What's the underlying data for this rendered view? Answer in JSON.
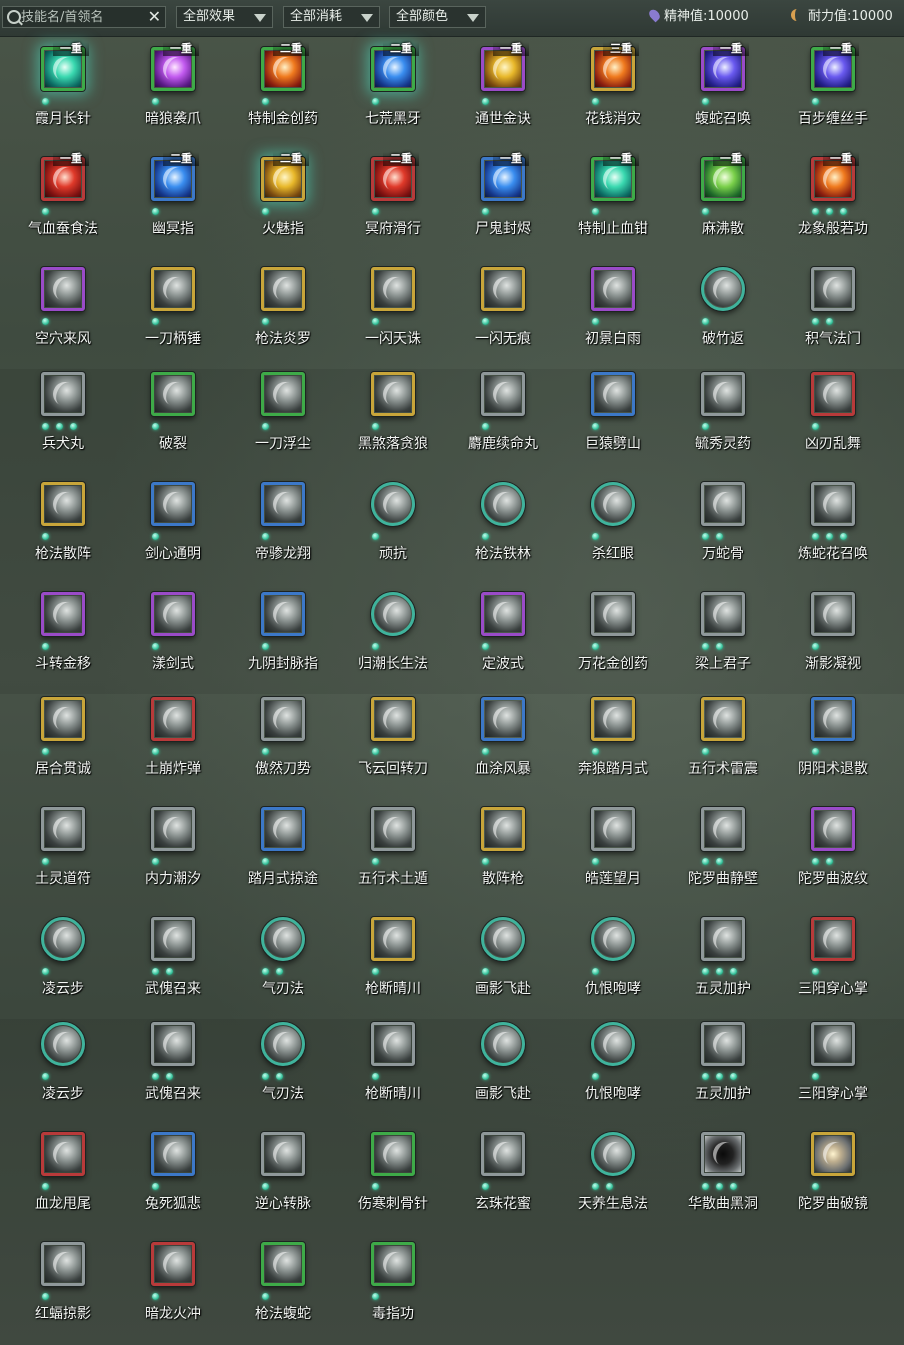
{
  "search": {
    "placeholder": "技能名/首领名",
    "value": "",
    "clear_label": "✕"
  },
  "filters": [
    {
      "label": "全部效果"
    },
    {
      "label": "全部消耗"
    },
    {
      "label": "全部颜色"
    }
  ],
  "stats": [
    {
      "label": "精神值:",
      "value": "10000",
      "icon": "spirit-icon"
    },
    {
      "label": "耐力值:",
      "value": "10000",
      "icon": "stamina-icon"
    }
  ],
  "skills": [
    {
      "name": "霞月长针",
      "badge": "一重",
      "dots": 1,
      "frame": "green",
      "shape": "square",
      "color": "teal",
      "glow": true
    },
    {
      "name": "暗狼袭爪",
      "badge": "一重",
      "dots": 1,
      "frame": "green",
      "shape": "square",
      "color": "purple"
    },
    {
      "name": "特制金创药",
      "badge": "二重",
      "dots": 1,
      "frame": "green",
      "shape": "square",
      "color": "fire"
    },
    {
      "name": "七荒黑牙",
      "badge": "二重",
      "dots": 1,
      "frame": "green",
      "shape": "square",
      "color": "blue",
      "glow": true
    },
    {
      "name": "通世金诀",
      "badge": "一重",
      "dots": 1,
      "frame": "purple",
      "shape": "square",
      "color": "gold"
    },
    {
      "name": "花钱消灾",
      "badge": "三重",
      "dots": 1,
      "frame": "gold",
      "shape": "square",
      "color": "fire"
    },
    {
      "name": "蝮蛇召唤",
      "badge": "一重",
      "dots": 1,
      "frame": "purple",
      "shape": "square",
      "color": "violet"
    },
    {
      "name": "百步缠丝手",
      "badge": "一重",
      "dots": 1,
      "frame": "green",
      "shape": "square",
      "color": "violet"
    },
    {
      "name": "气血蚕食法",
      "badge": "一重",
      "dots": 1,
      "frame": "red",
      "shape": "square",
      "color": "red"
    },
    {
      "name": "幽冥指",
      "badge": "二重",
      "dots": 1,
      "frame": "blue",
      "shape": "square",
      "color": "blue"
    },
    {
      "name": "火魅指",
      "badge": "二重",
      "dots": 1,
      "frame": "gold",
      "shape": "square",
      "color": "gold",
      "glow": true
    },
    {
      "name": "冥府滑行",
      "badge": "二重",
      "dots": 1,
      "frame": "red",
      "shape": "square",
      "color": "red"
    },
    {
      "name": "尸鬼封烬",
      "badge": "一重",
      "dots": 1,
      "frame": "blue",
      "shape": "square",
      "color": "blue"
    },
    {
      "name": "特制止血钳",
      "badge": "一重",
      "dots": 1,
      "frame": "green",
      "shape": "square",
      "color": "teal"
    },
    {
      "name": "麻沸散",
      "badge": "一重",
      "dots": 1,
      "frame": "green",
      "shape": "square",
      "color": "green"
    },
    {
      "name": "龙象般若功",
      "badge": "一重",
      "dots": 3,
      "frame": "red",
      "shape": "square",
      "color": "fire"
    },
    {
      "name": "空穴来风",
      "dots": 1,
      "frame": "purple",
      "shape": "square"
    },
    {
      "name": "一刀柄锤",
      "dots": 1,
      "frame": "gold",
      "shape": "square"
    },
    {
      "name": "枪法炎罗",
      "dots": 1,
      "frame": "gold",
      "shape": "square"
    },
    {
      "name": "一闪天诛",
      "dots": 1,
      "frame": "gold",
      "shape": "square"
    },
    {
      "name": "一闪无痕",
      "dots": 1,
      "frame": "gold",
      "shape": "square"
    },
    {
      "name": "初景白雨",
      "dots": 1,
      "frame": "purple",
      "shape": "square"
    },
    {
      "name": "破竹返",
      "dots": 1,
      "frame": "teal",
      "shape": "round"
    },
    {
      "name": "积气法门",
      "dots": 2,
      "frame": "gray",
      "shape": "square"
    },
    {
      "name": "兵犬丸",
      "dots": 3,
      "frame": "gray",
      "shape": "square"
    },
    {
      "name": "破裂",
      "dots": 1,
      "frame": "green",
      "shape": "square"
    },
    {
      "name": "一刀浮尘",
      "dots": 1,
      "frame": "green",
      "shape": "square"
    },
    {
      "name": "黑煞落贪狼",
      "dots": 1,
      "frame": "gold",
      "shape": "square"
    },
    {
      "name": "麝鹿续命丸",
      "dots": 1,
      "frame": "gray",
      "shape": "square"
    },
    {
      "name": "巨猿劈山",
      "dots": 1,
      "frame": "blue",
      "shape": "square"
    },
    {
      "name": "毓秀灵药",
      "dots": 1,
      "frame": "gray",
      "shape": "square"
    },
    {
      "name": "凶刃乱舞",
      "dots": 1,
      "frame": "red",
      "shape": "square"
    },
    {
      "name": "枪法散阵",
      "dots": 1,
      "frame": "gold",
      "shape": "square"
    },
    {
      "name": "剑心通明",
      "dots": 1,
      "frame": "blue",
      "shape": "square"
    },
    {
      "name": "帝骖龙翔",
      "dots": 1,
      "frame": "blue",
      "shape": "square"
    },
    {
      "name": "顽抗",
      "dots": 1,
      "frame": "teal",
      "shape": "round"
    },
    {
      "name": "枪法铁林",
      "dots": 1,
      "frame": "teal",
      "shape": "round"
    },
    {
      "name": "杀红眼",
      "dots": 1,
      "frame": "teal",
      "shape": "round"
    },
    {
      "name": "万蛇骨",
      "dots": 2,
      "frame": "gray",
      "shape": "square"
    },
    {
      "name": "炼蛇花召唤",
      "dots": 3,
      "frame": "gray",
      "shape": "square"
    },
    {
      "name": "斗转金移",
      "dots": 1,
      "frame": "purple",
      "shape": "square"
    },
    {
      "name": "漾剑式",
      "dots": 1,
      "frame": "purple",
      "shape": "square"
    },
    {
      "name": "九阴封脉指",
      "dots": 1,
      "frame": "blue",
      "shape": "square"
    },
    {
      "name": "归潮长生法",
      "dots": 1,
      "frame": "teal",
      "shape": "round"
    },
    {
      "name": "定波式",
      "dots": 1,
      "frame": "purple",
      "shape": "square"
    },
    {
      "name": "万花金创药",
      "dots": 1,
      "frame": "gray",
      "shape": "square"
    },
    {
      "name": "梁上君子",
      "dots": 2,
      "frame": "gray",
      "shape": "square"
    },
    {
      "name": "渐影凝视",
      "dots": 1,
      "frame": "gray",
      "shape": "square"
    },
    {
      "name": "居合贯诚",
      "dots": 1,
      "frame": "gold",
      "shape": "square"
    },
    {
      "name": "土崩炸弹",
      "dots": 1,
      "frame": "red",
      "shape": "square"
    },
    {
      "name": "傲然刀势",
      "dots": 1,
      "frame": "gray",
      "shape": "square"
    },
    {
      "name": "飞云回转刀",
      "dots": 1,
      "frame": "gold",
      "shape": "square"
    },
    {
      "name": "血涂风暴",
      "dots": 1,
      "frame": "blue",
      "shape": "square"
    },
    {
      "name": "奔狼踏月式",
      "dots": 1,
      "frame": "gold",
      "shape": "square"
    },
    {
      "name": "五行术雷震",
      "dots": 1,
      "frame": "gold",
      "shape": "square"
    },
    {
      "name": "阴阳术退散",
      "dots": 1,
      "frame": "blue",
      "shape": "square"
    },
    {
      "name": "土灵道符",
      "dots": 1,
      "frame": "gray",
      "shape": "square"
    },
    {
      "name": "内力潮汐",
      "dots": 1,
      "frame": "gray",
      "shape": "square"
    },
    {
      "name": "踏月式掠途",
      "dots": 1,
      "frame": "blue",
      "shape": "square"
    },
    {
      "name": "五行术土遁",
      "dots": 1,
      "frame": "gray",
      "shape": "square"
    },
    {
      "name": "散阵枪",
      "dots": 1,
      "frame": "gold",
      "shape": "square"
    },
    {
      "name": "皓莲望月",
      "dots": 1,
      "frame": "gray",
      "shape": "square"
    },
    {
      "name": "陀罗曲静壁",
      "dots": 2,
      "frame": "gray",
      "shape": "square"
    },
    {
      "name": "陀罗曲波纹",
      "dots": 2,
      "frame": "purple",
      "shape": "square"
    },
    {
      "name": "凌云步",
      "dots": 1,
      "frame": "teal",
      "shape": "round"
    },
    {
      "name": "武傀召来",
      "dots": 2,
      "frame": "gray",
      "shape": "square"
    },
    {
      "name": "气刃法",
      "dots": 2,
      "frame": "teal",
      "shape": "round"
    },
    {
      "name": "枪断晴川",
      "dots": 1,
      "frame": "gold",
      "shape": "square"
    },
    {
      "name": "画影飞赴",
      "dots": 1,
      "frame": "teal",
      "shape": "round"
    },
    {
      "name": "仇恨咆哮",
      "dots": 1,
      "frame": "teal",
      "shape": "round"
    },
    {
      "name": "五灵加护",
      "dots": 3,
      "frame": "gray",
      "shape": "square"
    },
    {
      "name": "三阳穿心掌",
      "dots": 1,
      "frame": "red",
      "shape": "square"
    },
    {
      "name": "凌云步",
      "dots": 1,
      "frame": "teal",
      "shape": "round"
    },
    {
      "name": "武傀召来",
      "dots": 2,
      "frame": "gray",
      "shape": "square"
    },
    {
      "name": "气刃法",
      "dots": 2,
      "frame": "teal",
      "shape": "round"
    },
    {
      "name": "枪断晴川",
      "dots": 1,
      "frame": "gray",
      "shape": "square"
    },
    {
      "name": "画影飞赴",
      "dots": 1,
      "frame": "teal",
      "shape": "round"
    },
    {
      "name": "仇恨咆哮",
      "dots": 1,
      "frame": "teal",
      "shape": "round"
    },
    {
      "name": "五灵加护",
      "dots": 3,
      "frame": "gray",
      "shape": "square"
    },
    {
      "name": "三阳穿心掌",
      "dots": 1,
      "frame": "gray",
      "shape": "square"
    },
    {
      "name": "血龙甩尾",
      "dots": 1,
      "frame": "red",
      "shape": "square"
    },
    {
      "name": "兔死狐悲",
      "dots": 1,
      "frame": "blue",
      "shape": "square"
    },
    {
      "name": "逆心转脉",
      "dots": 1,
      "frame": "gray",
      "shape": "square"
    },
    {
      "name": "伤寒刺骨针",
      "dots": 1,
      "frame": "green",
      "shape": "square"
    },
    {
      "name": "玄珠花蜜",
      "dots": 1,
      "frame": "gray",
      "shape": "square"
    },
    {
      "name": "天养生息法",
      "dots": 2,
      "frame": "teal",
      "shape": "round"
    },
    {
      "name": "华散曲黑洞",
      "dots": 3,
      "frame": "gray",
      "shape": "square",
      "color": "dark"
    },
    {
      "name": "陀罗曲破镜",
      "dots": 1,
      "frame": "gold",
      "shape": "square",
      "color": "swirl"
    },
    {
      "name": "红蝠掠影",
      "dots": 1,
      "frame": "gray",
      "shape": "square"
    },
    {
      "name": "暗龙火冲",
      "dots": 1,
      "frame": "red",
      "shape": "square"
    },
    {
      "name": "枪法蝮蛇",
      "dots": 1,
      "frame": "green",
      "shape": "square"
    },
    {
      "name": "毒指功",
      "dots": 1,
      "frame": "green",
      "shape": "square"
    }
  ]
}
